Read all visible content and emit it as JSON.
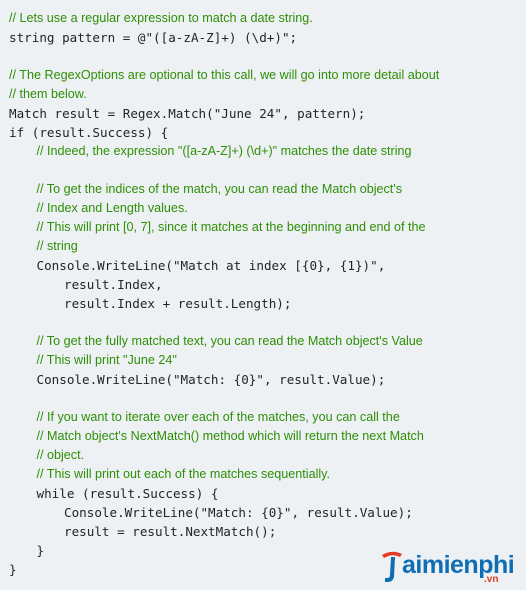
{
  "code_lines": [
    {
      "kind": "comment",
      "indent": 0,
      "text": "// Lets use a regular expression to match a date string."
    },
    {
      "kind": "code",
      "indent": 0,
      "text": "string pattern = @\"([a-zA-Z]+) (\\d+)\";"
    },
    {
      "kind": "blank",
      "indent": 0,
      "text": ""
    },
    {
      "kind": "comment",
      "indent": 0,
      "text": "// The RegexOptions are optional to this call, we will go into more detail about"
    },
    {
      "kind": "comment",
      "indent": 0,
      "text": "// them below."
    },
    {
      "kind": "code",
      "indent": 0,
      "text": "Match result = Regex.Match(\"June 24\", pattern);"
    },
    {
      "kind": "code",
      "indent": 0,
      "text": "if (result.Success) {"
    },
    {
      "kind": "comment",
      "indent": 1,
      "text": "// Indeed, the expression \"([a-zA-Z]+) (\\d+)\" matches the date string"
    },
    {
      "kind": "blank",
      "indent": 0,
      "text": ""
    },
    {
      "kind": "comment",
      "indent": 1,
      "text": "// To get the indices of the match, you can read the Match object's"
    },
    {
      "kind": "comment",
      "indent": 1,
      "text": "// Index and Length values."
    },
    {
      "kind": "comment",
      "indent": 1,
      "text": "// This will print [0, 7], since it matches at the beginning and end of the"
    },
    {
      "kind": "comment",
      "indent": 1,
      "text": "// string"
    },
    {
      "kind": "code",
      "indent": 1,
      "text": "Console.WriteLine(\"Match at index [{0}, {1})\","
    },
    {
      "kind": "code",
      "indent": 2,
      "text": "result.Index,"
    },
    {
      "kind": "code",
      "indent": 2,
      "text": "result.Index + result.Length);"
    },
    {
      "kind": "blank",
      "indent": 0,
      "text": ""
    },
    {
      "kind": "comment",
      "indent": 1,
      "text": "// To get the fully matched text, you can read the Match object's Value"
    },
    {
      "kind": "comment",
      "indent": 1,
      "text": "// This will print \"June 24\""
    },
    {
      "kind": "code",
      "indent": 1,
      "text": "Console.WriteLine(\"Match: {0}\", result.Value);"
    },
    {
      "kind": "blank",
      "indent": 0,
      "text": ""
    },
    {
      "kind": "comment",
      "indent": 1,
      "text": "// If you want to iterate over each of the matches, you can call the"
    },
    {
      "kind": "comment",
      "indent": 1,
      "text": "// Match object's NextMatch() method which will return the next Match"
    },
    {
      "kind": "comment",
      "indent": 1,
      "text": "// object."
    },
    {
      "kind": "comment",
      "indent": 1,
      "text": "// This will print out each of the matches sequentially."
    },
    {
      "kind": "code",
      "indent": 1,
      "text": "while (result.Success) {"
    },
    {
      "kind": "code",
      "indent": 2,
      "text": "Console.WriteLine(\"Match: {0}\", result.Value);"
    },
    {
      "kind": "code",
      "indent": 2,
      "text": "result = result.NextMatch();"
    },
    {
      "kind": "code",
      "indent": 1,
      "text": "}"
    },
    {
      "kind": "code",
      "indent": 0,
      "text": "}"
    }
  ],
  "colors": {
    "background": "#eef1f4",
    "comment": "#2d8f06",
    "code": "#242424",
    "watermark_blue": "#0f6db4",
    "watermark_red": "#e33b23"
  },
  "watermark": {
    "brand": "aimienphi",
    "tld": ".vn",
    "logo_icon": "taimienphi-logo-icon"
  }
}
